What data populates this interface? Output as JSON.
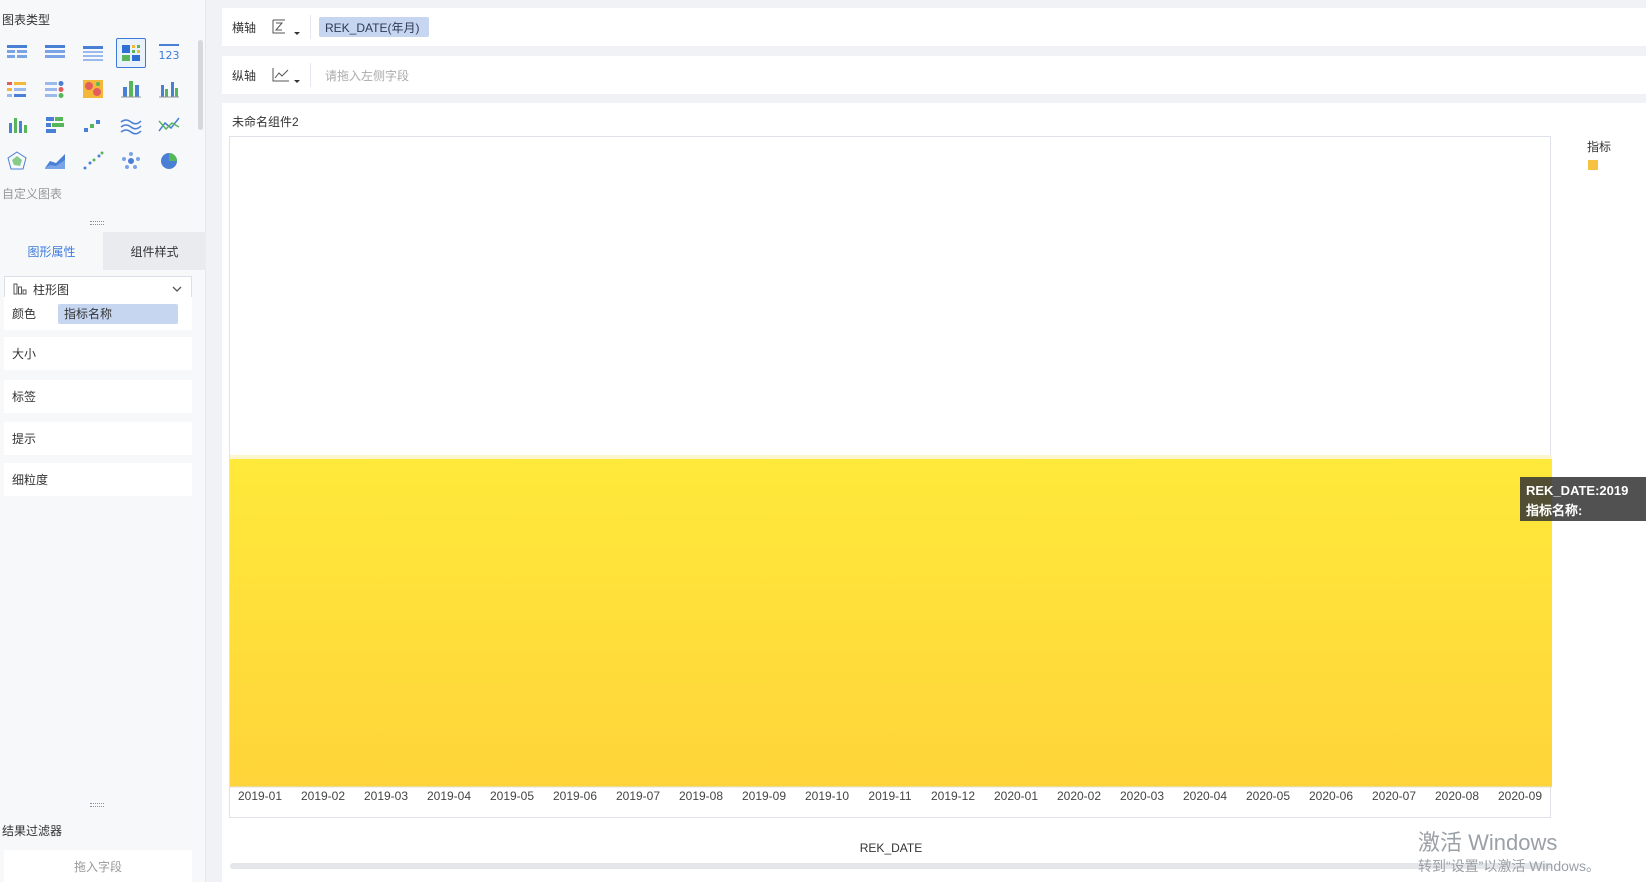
{
  "left_panel": {
    "chart_types_title": "图表类型",
    "custom_chart_label": "自定义图表",
    "tabs": [
      {
        "label": "图形属性",
        "active": true
      },
      {
        "label": "组件样式",
        "active": false
      }
    ],
    "chart_type_select": {
      "icon": "bar-chart-icon",
      "value": "柱形图"
    },
    "properties": {
      "color_label": "颜色",
      "color_field": "指标名称",
      "size_label": "大小",
      "label_label": "标签",
      "tooltip_label": "提示",
      "granularity_label": "细粒度"
    },
    "filter_title": "结果过滤器",
    "filter_drop_hint": "拖入字段"
  },
  "x_axis": {
    "label": "横轴",
    "field": "REK_DATE(年月)",
    "icon": "axis-type-icon"
  },
  "y_axis": {
    "label": "纵轴",
    "placeholder": "请拖入左侧字段",
    "icon": "line-axis-icon"
  },
  "component_title": "未命名组件2",
  "legend": {
    "title": "指标",
    "color": "#f5c242"
  },
  "tooltip": {
    "line1": "REK_DATE:2019",
    "line2": "指标名称:"
  },
  "chart_data": {
    "type": "bar",
    "xlabel": "REK_DATE",
    "categories": [
      "2019-01",
      "2019-02",
      "2019-03",
      "2019-04",
      "2019-05",
      "2019-06",
      "2019-07",
      "2019-08",
      "2019-09",
      "2019-10",
      "2019-11",
      "2019-12",
      "2020-01",
      "2020-02",
      "2020-03",
      "2020-04",
      "2020-05",
      "2020-06",
      "2020-07",
      "2020-08",
      "2020-09"
    ],
    "highlight_color_top": "#ffe93a",
    "highlight_color_bottom": "#ffd43a"
  },
  "watermark": {
    "line1": "激活 Windows",
    "line2": "转到“设置”以激活 Windows。"
  }
}
